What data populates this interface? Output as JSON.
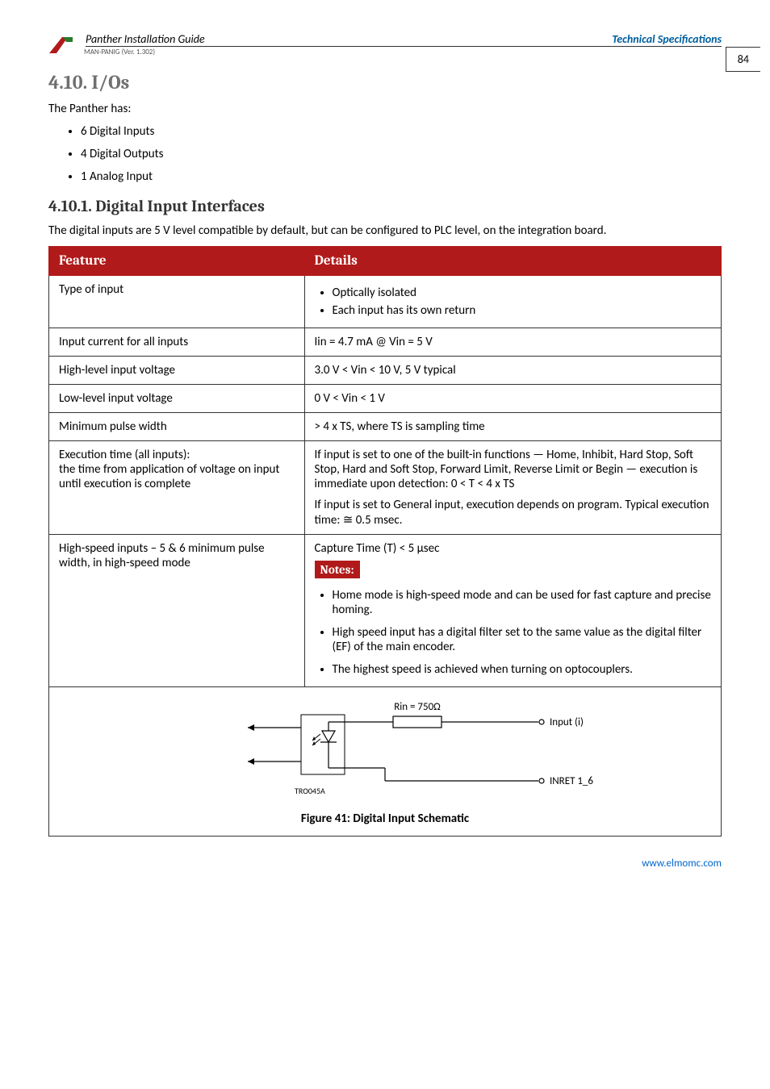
{
  "header": {
    "doc_title": "Panther Installation Guide",
    "section_title": "Technical Specifications",
    "doc_code": "MAN-PANIG (Ver. 1.302)",
    "page_number": "84"
  },
  "section": {
    "number_title": "4.10.  I/Os",
    "intro": "The Panther has:",
    "bullets": [
      "6 Digital Inputs",
      "4 Digital Outputs",
      "1 Analog Input"
    ]
  },
  "subsection": {
    "number_title": "4.10.1.     Digital Input Interfaces",
    "intro": "The digital inputs are 5 V level compatible by default, but can be configured to PLC level, on the integration board."
  },
  "table": {
    "head": {
      "c1": "Feature",
      "c2": "Details"
    },
    "rows": [
      {
        "feature": "Type of input",
        "details_list": [
          "Optically isolated",
          "Each input has its own return"
        ]
      },
      {
        "feature": "Input current for all inputs",
        "details_text": "Iin = 4.7 mA @ Vin = 5 V"
      },
      {
        "feature": "High-level input voltage",
        "details_text": "3.0 V < Vin < 10 V, 5 V typical"
      },
      {
        "feature": "Low-level input voltage",
        "details_text": "0 V < Vin < 1 V"
      },
      {
        "feature": "Minimum pulse width",
        "details_text": "> 4 x TS, where TS is sampling time"
      },
      {
        "feature": "Execution time (all inputs):\nthe time from application of voltage on input until execution is complete",
        "details_para1": "If input is set to one of the built-in functions — Home, Inhibit, Hard Stop, Soft Stop, Hard and Soft Stop, Forward Limit, Reverse Limit or Begin — execution is immediate upon detection: 0 < T < 4 x TS",
        "details_para2": "If input is set to General input, execution depends on program. Typical execution time: ≅ 0.5 msec."
      },
      {
        "feature": "High-speed inputs – 5 & 6 minimum pulse width, in high-speed mode",
        "capture_line": "Capture Time (T) < 5 µsec",
        "notes_label": "Notes:",
        "notes": [
          "Home mode is high-speed mode and can be used for fast capture and precise homing.",
          "High speed input has a digital filter set to the same value as the digital filter (EF) of the main encoder.",
          "The highest speed is achieved when turning on optocouplers."
        ]
      }
    ],
    "figure": {
      "rin_label": "Rin = 750Ω",
      "input_label": "Input (i)",
      "inret_label": "INRET 1_6",
      "tro_label": "TRO045A",
      "caption": "Figure 41: Digital Input Schematic"
    }
  },
  "footer": {
    "url": "www.elmomc.com"
  }
}
